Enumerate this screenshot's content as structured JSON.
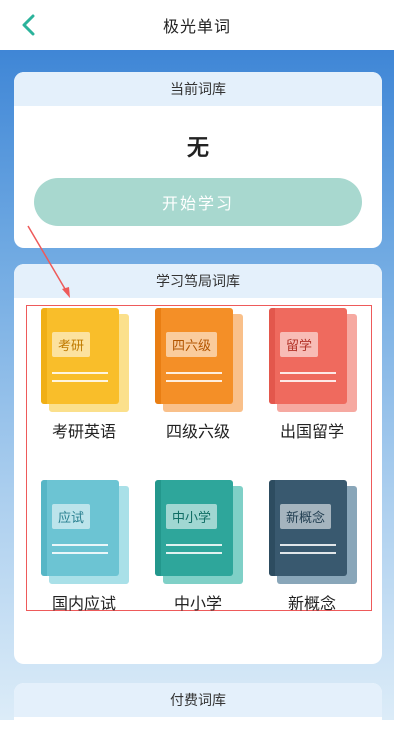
{
  "app": {
    "title": "极光单词"
  },
  "current": {
    "header": "当前词库",
    "value": "无",
    "start_label": "开始学习"
  },
  "library": {
    "header": "学习笃局词库",
    "books": [
      {
        "tag": "考研",
        "label": "考研英语",
        "cover": "#f9be2a",
        "pages": "#fbe08c",
        "spine": "#e8a000",
        "tag_color": "#c07a00"
      },
      {
        "tag": "四六级",
        "label": "四级六级",
        "cover": "#f48f27",
        "pages": "#f9c08a",
        "spine": "#dd6e00",
        "tag_color": "#b35500"
      },
      {
        "tag": "留学",
        "label": "出国留学",
        "cover": "#ef6a5e",
        "pages": "#f6a9a1",
        "spine": "#d8443a",
        "tag_color": "#b23328"
      },
      {
        "tag": "应试",
        "label": "国内应试",
        "cover": "#6cc4d3",
        "pages": "#a9e0e8",
        "spine": "#3fa8ba",
        "tag_color": "#2a8191"
      },
      {
        "tag": "中小学",
        "label": "中小学",
        "cover": "#2ea69b",
        "pages": "#7fd0c7",
        "spine": "#17877d",
        "tag_color": "#0f6d64"
      },
      {
        "tag": "新概念",
        "label": "新概念",
        "cover": "#39596f",
        "pages": "#89a6b9",
        "spine": "#223f52",
        "tag_color": "#223f52"
      }
    ]
  },
  "paid": {
    "header": "付费词库"
  },
  "colors": {
    "accent": "#2bb39b",
    "annotation_red": "#ee5a5a"
  }
}
